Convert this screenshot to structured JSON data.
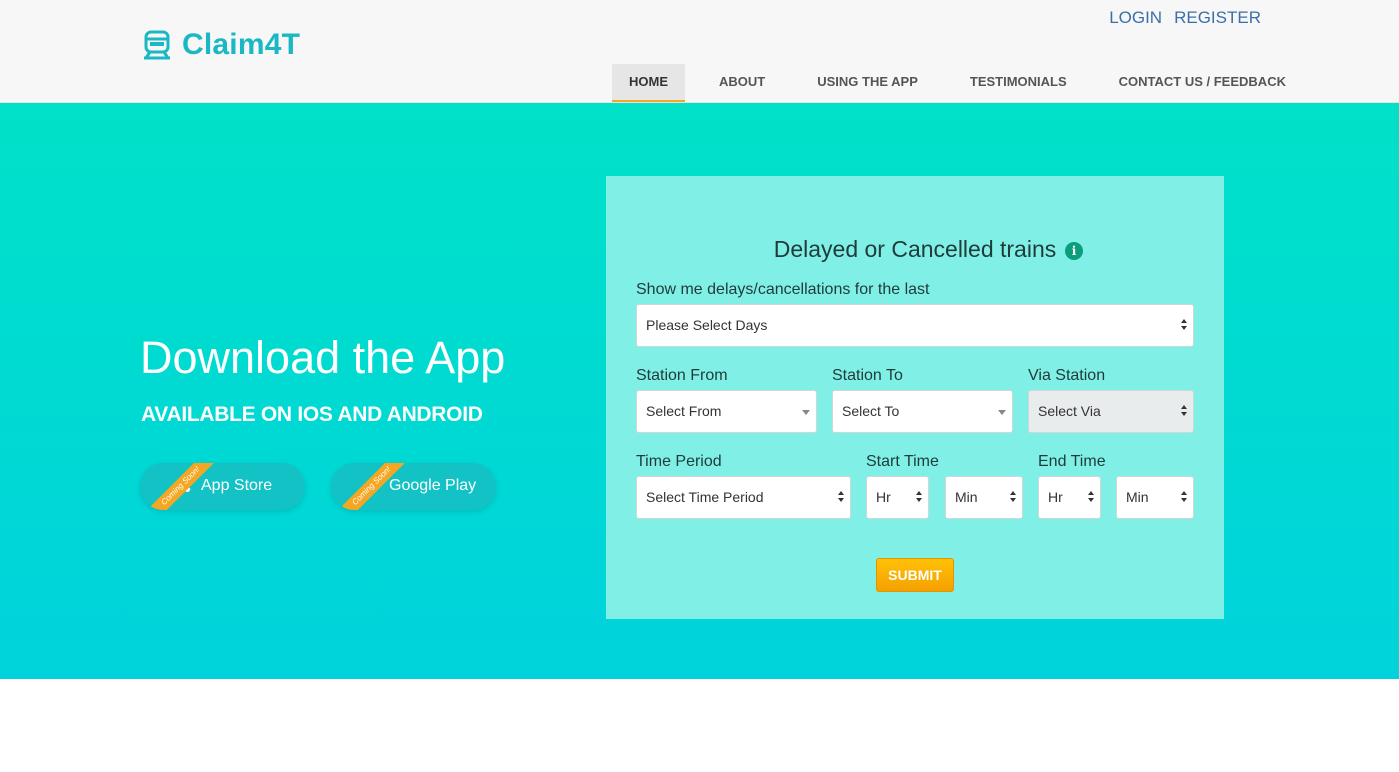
{
  "brand": {
    "name": "Claim4T",
    "icon": "train-icon",
    "color": "#1ab8c4"
  },
  "auth": {
    "login": "LOGIN",
    "register": "REGISTER"
  },
  "nav": {
    "items": [
      {
        "label": "HOME",
        "active": true
      },
      {
        "label": "ABOUT",
        "active": false
      },
      {
        "label": "USING THE APP",
        "active": false
      },
      {
        "label": "TESTIMONIALS",
        "active": false
      },
      {
        "label": "CONTACT US / FEEDBACK",
        "active": false
      }
    ]
  },
  "hero": {
    "title": "Download the App",
    "subtitle": "AVAILABLE ON IOS AND ANDROID",
    "stores": [
      {
        "label": "App Store",
        "ribbon": "Coming Soon!",
        "icon": "apple-icon"
      },
      {
        "label": "Google Play",
        "ribbon": "Coming Soon!",
        "icon": "google-play-icon"
      }
    ]
  },
  "form": {
    "title": "Delayed or Cancelled trains",
    "info_icon": "i",
    "days_label": "Show me delays/cancellations for the last",
    "days_value": "Please Select Days",
    "station_from_label": "Station From",
    "station_from_value": "Select From",
    "station_to_label": "Station To",
    "station_to_value": "Select To",
    "via_label": "Via Station",
    "via_value": "Select Via",
    "time_period_label": "Time Period",
    "time_period_value": "Select Time Period",
    "start_time_label": "Start Time",
    "start_hr": "Hr",
    "start_min": "Min",
    "end_time_label": "End Time",
    "end_hr": "Hr",
    "end_min": "Min",
    "submit": "SUBMIT"
  },
  "colors": {
    "hero_top": "#00e1c8",
    "hero_bottom": "#00d3dc",
    "panel": "#80efe6",
    "accent": "#f5a623",
    "link": "#3a6fa8"
  }
}
